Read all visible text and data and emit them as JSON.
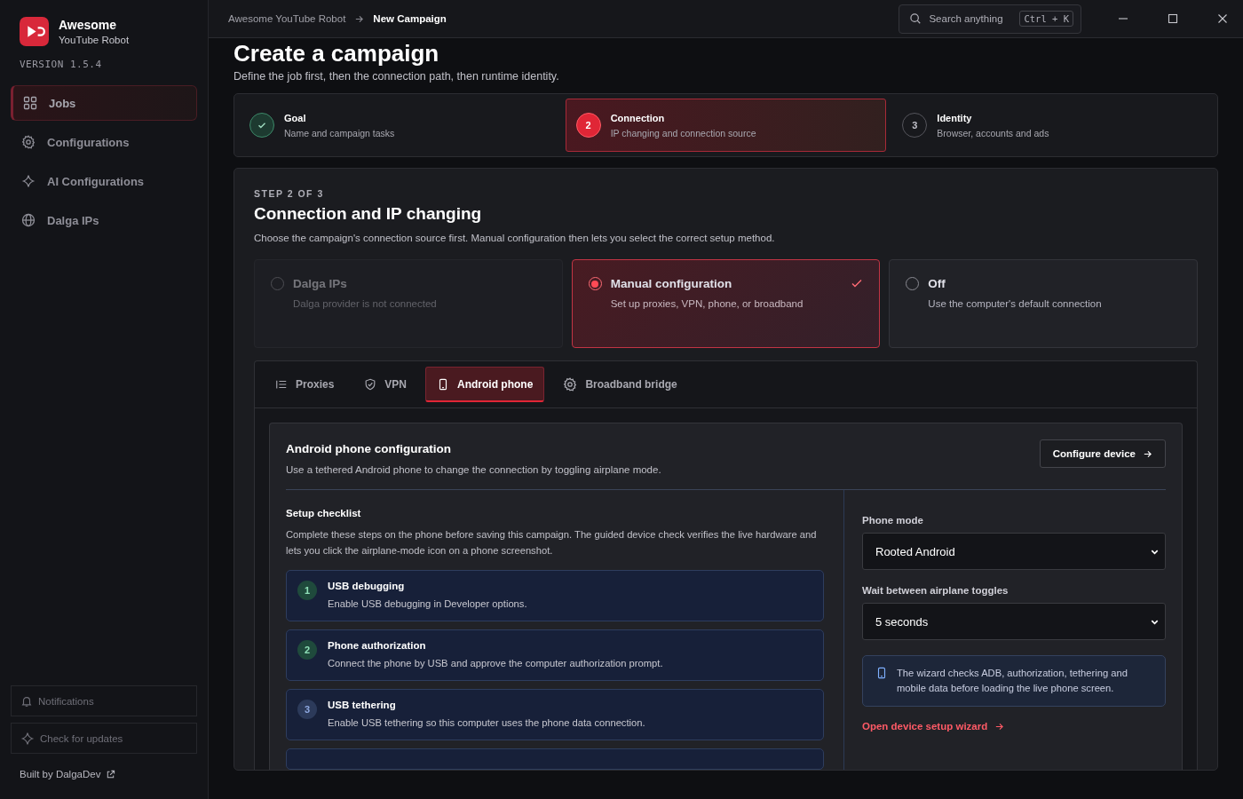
{
  "app": {
    "name": "Awesome",
    "subtitle": "YouTube Robot",
    "version": "VERSION 1.5.4"
  },
  "sidebar": {
    "items": [
      {
        "label": "Jobs",
        "selected": true
      },
      {
        "label": "Configurations",
        "selected": false
      },
      {
        "label": "AI Configurations",
        "selected": false
      },
      {
        "label": "Dalga IPs",
        "selected": false
      }
    ],
    "footer_buttons": [
      "Notifications",
      "Check for updates"
    ],
    "credit": "Built by DalgaDev"
  },
  "breadcrumb": [
    "Awesome YouTube Robot",
    "New Campaign"
  ],
  "search": {
    "placeholder": "Search anything",
    "shortcut": "Ctrl + K"
  },
  "page": {
    "title": "Create a campaign",
    "subtitle": "Define the job first, then the connection path, then runtime identity."
  },
  "stepper": [
    {
      "title": "Goal",
      "desc": "Name and campaign tasks",
      "done": true,
      "selected": false
    },
    {
      "number": "2",
      "title": "Connection",
      "desc": "IP changing and connection source",
      "done": false,
      "selected": true
    },
    {
      "number": "3",
      "title": "Identity",
      "desc": "Browser, accounts and ads",
      "done": false,
      "selected": false
    }
  ],
  "step": {
    "eyebrow": "STEP 2 OF 3",
    "title": "Connection and IP changing",
    "desc": "Choose the campaign's connection source first. Manual configuration then lets you select the correct setup method."
  },
  "sources": [
    {
      "title": "Dalga IPs",
      "desc": "Dalga provider is not connected",
      "selected": false,
      "disabled": true
    },
    {
      "title": "Manual configuration",
      "desc": "Set up proxies, VPN, phone, or broadband",
      "selected": true,
      "disabled": false
    },
    {
      "title": "Off",
      "desc": "Use the computer's default connection",
      "selected": false,
      "disabled": false
    }
  ],
  "tabs": [
    {
      "label": "Proxies",
      "selected": false
    },
    {
      "label": "VPN",
      "selected": false
    },
    {
      "label": "Android phone",
      "selected": true
    },
    {
      "label": "Broadband bridge",
      "selected": false
    }
  ],
  "panel": {
    "title": "Android phone configuration",
    "desc": "Use a tethered Android phone to change the connection by toggling airplane mode.",
    "action": "Configure device",
    "checklist_title": "Setup checklist",
    "checklist_desc": "Complete these steps on the phone before saving this campaign. The guided device check verifies the live hardware and lets you click the airplane-mode icon on a phone screenshot.",
    "checklist": [
      {
        "number": "1",
        "title": "USB debugging",
        "desc": "Enable USB debugging in Developer options.",
        "done": true
      },
      {
        "number": "2",
        "title": "Phone authorization",
        "desc": "Connect the phone by USB and approve the computer authorization prompt.",
        "done": true
      },
      {
        "number": "3",
        "title": "USB tethering",
        "desc": "Enable USB tethering so this computer uses the phone data connection.",
        "done": false
      }
    ],
    "fields": [
      {
        "label": "Phone mode",
        "value": "Rooted Android"
      },
      {
        "label": "Wait between airplane toggles",
        "value": "5 seconds"
      }
    ],
    "note": "The wizard checks ADB, authorization, tethering and mobile data before loading the live phone screen.",
    "link": "Open device setup wizard"
  }
}
